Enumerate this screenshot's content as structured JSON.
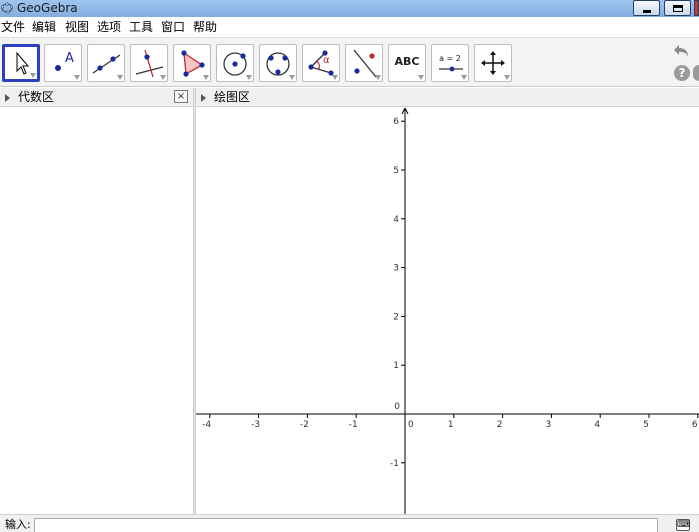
{
  "window": {
    "title": "GeoGebra"
  },
  "menu": [
    "文件",
    "编辑",
    "视图",
    "选项",
    "工具",
    "窗口",
    "帮助"
  ],
  "toolbar": {
    "tools": [
      {
        "name": "move-tool",
        "icon": "pointer-arrow-icon",
        "selected": true
      },
      {
        "name": "point-tool",
        "icon": "point-a-icon",
        "label": "A"
      },
      {
        "name": "line-tool",
        "icon": "line-through-two-points-icon"
      },
      {
        "name": "perpendicular-tool",
        "icon": "perpendicular-line-icon"
      },
      {
        "name": "polygon-tool",
        "icon": "polygon-icon"
      },
      {
        "name": "circle-tool",
        "icon": "circle-center-point-icon"
      },
      {
        "name": "ellipse-tool",
        "icon": "ellipse-three-points-icon"
      },
      {
        "name": "angle-tool",
        "icon": "angle-alpha-icon",
        "label": "α"
      },
      {
        "name": "reflect-tool",
        "icon": "reflect-about-line-icon"
      },
      {
        "name": "text-tool",
        "icon": "text-abc-icon",
        "label": "ABC"
      },
      {
        "name": "slider-tool",
        "icon": "slider-a-equals-2-icon",
        "label": "a = 2"
      },
      {
        "name": "move-graphics-tool",
        "icon": "move-graphics-view-icon"
      }
    ],
    "undo_icon": "undo-icon",
    "help_icon": "help-icon",
    "help_label": "?"
  },
  "algebra_view": {
    "title": "代数区",
    "close_label": "×"
  },
  "graphics_view": {
    "title": "绘图区",
    "x_ticks": [
      "-4",
      "-3",
      "-2",
      "-1",
      "0",
      "1",
      "2",
      "3",
      "4",
      "5",
      "6"
    ],
    "y_ticks": [
      "6",
      "5",
      "4",
      "3",
      "2",
      "1",
      "0",
      "-1"
    ],
    "grid": false,
    "axis_color": "#000000"
  },
  "input_bar": {
    "label": "输入:",
    "value": "",
    "keyboard_icon": "keyboard-icon",
    "keyboard_label": "⌨"
  },
  "colors": {
    "title_bar": "#9fc4ee",
    "selected_tool_border": "#2b3fbf",
    "point_blue": "#1a2a9c",
    "accent_red": "#c0282d"
  }
}
